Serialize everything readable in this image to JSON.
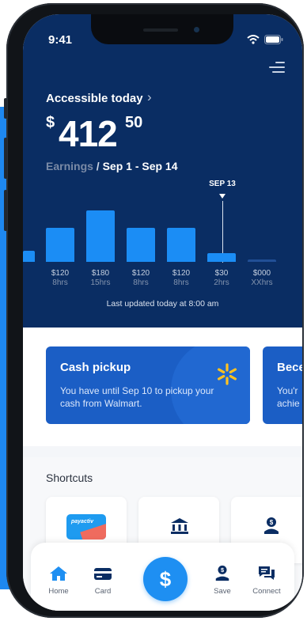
{
  "status_bar": {
    "time": "9:41"
  },
  "accessible": {
    "title": "Accessible today",
    "currency": "$",
    "amount_whole": "412",
    "amount_cents": "50"
  },
  "earnings": {
    "label": "Earnings",
    "separator": "/",
    "range": "Sep 1 - Sep 14"
  },
  "chart_data": {
    "type": "bar",
    "categories": [
      "8hrs",
      "15hrs",
      "8hrs",
      "8hrs",
      "2hrs",
      "XXhrs"
    ],
    "value_labels": [
      "$120",
      "$180",
      "$120",
      "$120",
      "$30",
      "$000"
    ],
    "values": [
      120,
      180,
      120,
      120,
      30,
      0
    ],
    "highlight_label": "SEP 13"
  },
  "updated_text": "Last updated today at 8:00 am",
  "cards": [
    {
      "title": "Cash pickup",
      "desc": "You have until Sep 10 to pickup your cash from Walmart.",
      "icon": "walmart-spark-icon"
    },
    {
      "title": "Bece",
      "desc": "You'r achie"
    }
  ],
  "shortcuts": {
    "title": "Shortcuts",
    "card_brand": "payactiv"
  },
  "tabbar": {
    "items": [
      {
        "label": "Home",
        "icon": "home-icon"
      },
      {
        "label": "Card",
        "icon": "card-icon"
      },
      {
        "label": "Save",
        "icon": "save-icon"
      },
      {
        "label": "Connect",
        "icon": "chat-icon"
      }
    ],
    "center_symbol": "$"
  },
  "colors": {
    "hero_bg": "#0a2d63",
    "accent": "#1b8df5",
    "card_bg": "#1b5ec5",
    "walmart_yellow": "#ffc220"
  }
}
